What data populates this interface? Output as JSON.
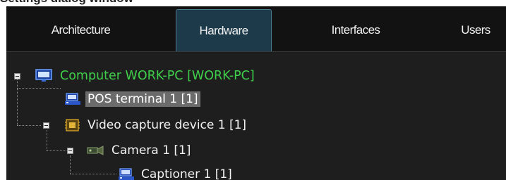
{
  "page": {
    "header_text": "Settings dialog window"
  },
  "tabs": [
    {
      "label": "Architecture",
      "active": false
    },
    {
      "label": "Hardware",
      "active": true
    },
    {
      "label": "Interfaces",
      "active": false
    },
    {
      "label": "Users",
      "active": false
    }
  ],
  "tree": {
    "computer": {
      "label": "Computer WORK-PC [WORK-PC]",
      "icon": "monitor-icon",
      "expanded": true
    },
    "pos_terminal": {
      "label": "POS terminal 1 [1]",
      "icon": "pos-terminal-icon",
      "selected": true
    },
    "video_capture": {
      "label": "Video capture device 1 [1]",
      "icon": "chip-icon",
      "expanded": true
    },
    "camera": {
      "label": "Camera 1 [1]",
      "icon": "camera-icon",
      "expanded": true
    },
    "captioner": {
      "label": "Captioner 1 [1]",
      "icon": "captioner-icon"
    }
  },
  "colors": {
    "root_label": "#3fcf4b",
    "active_tab": "#1c3a4a",
    "selection": "#6b6b6b",
    "background": "#1e1e1e"
  }
}
